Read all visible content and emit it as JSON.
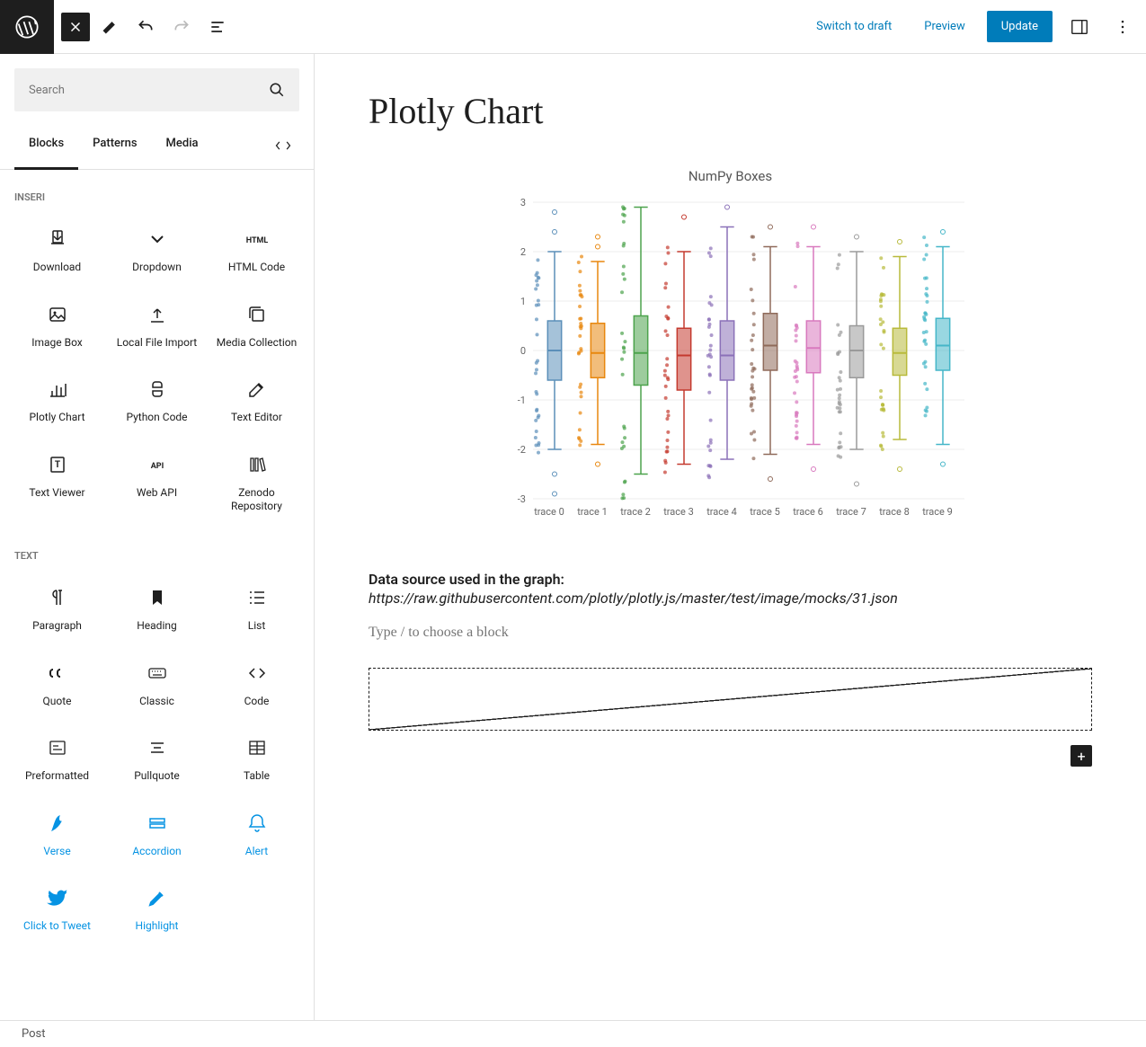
{
  "topbar": {
    "switch_draft": "Switch to draft",
    "preview": "Preview",
    "update": "Update"
  },
  "search": {
    "placeholder": "Search"
  },
  "tabs": {
    "blocks": "Blocks",
    "patterns": "Patterns",
    "media": "Media"
  },
  "sections": {
    "inseri": {
      "title": "INSERI",
      "items": [
        {
          "label": "Download",
          "icon": "download"
        },
        {
          "label": "Dropdown",
          "icon": "dropdown"
        },
        {
          "label": "HTML Code",
          "icon": "html"
        },
        {
          "label": "Image Box",
          "icon": "image"
        },
        {
          "label": "Local File Import",
          "icon": "upload"
        },
        {
          "label": "Media Collection",
          "icon": "collection"
        },
        {
          "label": "Plotly Chart",
          "icon": "chart"
        },
        {
          "label": "Python Code",
          "icon": "python"
        },
        {
          "label": "Text Editor",
          "icon": "edit"
        },
        {
          "label": "Text Viewer",
          "icon": "textview"
        },
        {
          "label": "Web API",
          "icon": "api"
        },
        {
          "label": "Zenodo Repository",
          "icon": "books"
        }
      ]
    },
    "text": {
      "title": "TEXT",
      "items": [
        {
          "label": "Paragraph",
          "icon": "pilcrow"
        },
        {
          "label": "Heading",
          "icon": "bookmark"
        },
        {
          "label": "List",
          "icon": "list"
        },
        {
          "label": "Quote",
          "icon": "quote"
        },
        {
          "label": "Classic",
          "icon": "keyboard"
        },
        {
          "label": "Code",
          "icon": "code"
        },
        {
          "label": "Preformatted",
          "icon": "pre"
        },
        {
          "label": "Pullquote",
          "icon": "pullquote"
        },
        {
          "label": "Table",
          "icon": "table"
        },
        {
          "label": "Verse",
          "icon": "verse",
          "teal": true
        },
        {
          "label": "Accordion",
          "icon": "accordion",
          "teal": true
        },
        {
          "label": "Alert",
          "icon": "alert",
          "teal": true
        },
        {
          "label": "Click to Tweet",
          "icon": "tweet",
          "teal": true
        },
        {
          "label": "Highlight",
          "icon": "highlight",
          "teal": true
        }
      ]
    }
  },
  "page": {
    "title": "Plotly Chart",
    "data_source_label": "Data source used in the graph:",
    "data_source_url": "https://raw.githubusercontent.com/plotly/plotly.js/master/test/image/mocks/31.json",
    "placeholder": "Type / to choose a block"
  },
  "chart_data": {
    "type": "box",
    "title": "NumPy Boxes",
    "ylim": [
      -3,
      3
    ],
    "yticks": [
      -3,
      -2,
      -1,
      0,
      1,
      2,
      3
    ],
    "categories": [
      "trace 0",
      "trace 1",
      "trace 2",
      "trace 3",
      "trace 4",
      "trace 5",
      "trace 6",
      "trace 7",
      "trace 8",
      "trace 9"
    ],
    "series": [
      {
        "name": "trace 0",
        "color": "#5B8FB9",
        "q1": -0.6,
        "median": 0.0,
        "q3": 0.6,
        "whisker_low": -2.0,
        "whisker_high": 2.0,
        "outliers": [
          -2.9,
          -2.5,
          2.4,
          2.8
        ]
      },
      {
        "name": "trace 1",
        "color": "#E8870E",
        "q1": -0.55,
        "median": -0.05,
        "q3": 0.55,
        "whisker_low": -1.9,
        "whisker_high": 1.8,
        "outliers": [
          -2.3,
          2.1,
          2.3
        ]
      },
      {
        "name": "trace 2",
        "color": "#4CA34C",
        "q1": -0.7,
        "median": -0.05,
        "q3": 0.7,
        "whisker_low": -2.5,
        "whisker_high": 2.9,
        "outliers": []
      },
      {
        "name": "trace 3",
        "color": "#C43A2F",
        "q1": -0.8,
        "median": -0.1,
        "q3": 0.45,
        "whisker_low": -2.3,
        "whisker_high": 2.0,
        "outliers": [
          2.7
        ]
      },
      {
        "name": "trace 4",
        "color": "#8B71B8",
        "q1": -0.6,
        "median": -0.1,
        "q3": 0.6,
        "whisker_low": -2.2,
        "whisker_high": 2.5,
        "outliers": [
          2.9
        ]
      },
      {
        "name": "trace 5",
        "color": "#8F6A5A",
        "q1": -0.4,
        "median": 0.1,
        "q3": 0.75,
        "whisker_low": -2.1,
        "whisker_high": 2.1,
        "outliers": [
          -2.6,
          2.5
        ]
      },
      {
        "name": "trace 6",
        "color": "#D879BE",
        "q1": -0.45,
        "median": 0.05,
        "q3": 0.6,
        "whisker_low": -1.9,
        "whisker_high": 2.1,
        "outliers": [
          2.5,
          -2.4
        ]
      },
      {
        "name": "trace 7",
        "color": "#9A9A9A",
        "q1": -0.55,
        "median": 0.0,
        "q3": 0.5,
        "whisker_low": -2.0,
        "whisker_high": 2.0,
        "outliers": [
          -2.7,
          2.3
        ]
      },
      {
        "name": "trace 8",
        "color": "#B8BA3B",
        "q1": -0.5,
        "median": -0.05,
        "q3": 0.45,
        "whisker_low": -1.8,
        "whisker_high": 1.9,
        "outliers": [
          -2.4,
          2.2
        ]
      },
      {
        "name": "trace 9",
        "color": "#45B6C8",
        "q1": -0.4,
        "median": 0.1,
        "q3": 0.65,
        "whisker_low": -1.9,
        "whisker_high": 2.1,
        "outliers": [
          2.4,
          -2.3
        ]
      }
    ]
  },
  "footer": {
    "breadcrumb": "Post"
  }
}
